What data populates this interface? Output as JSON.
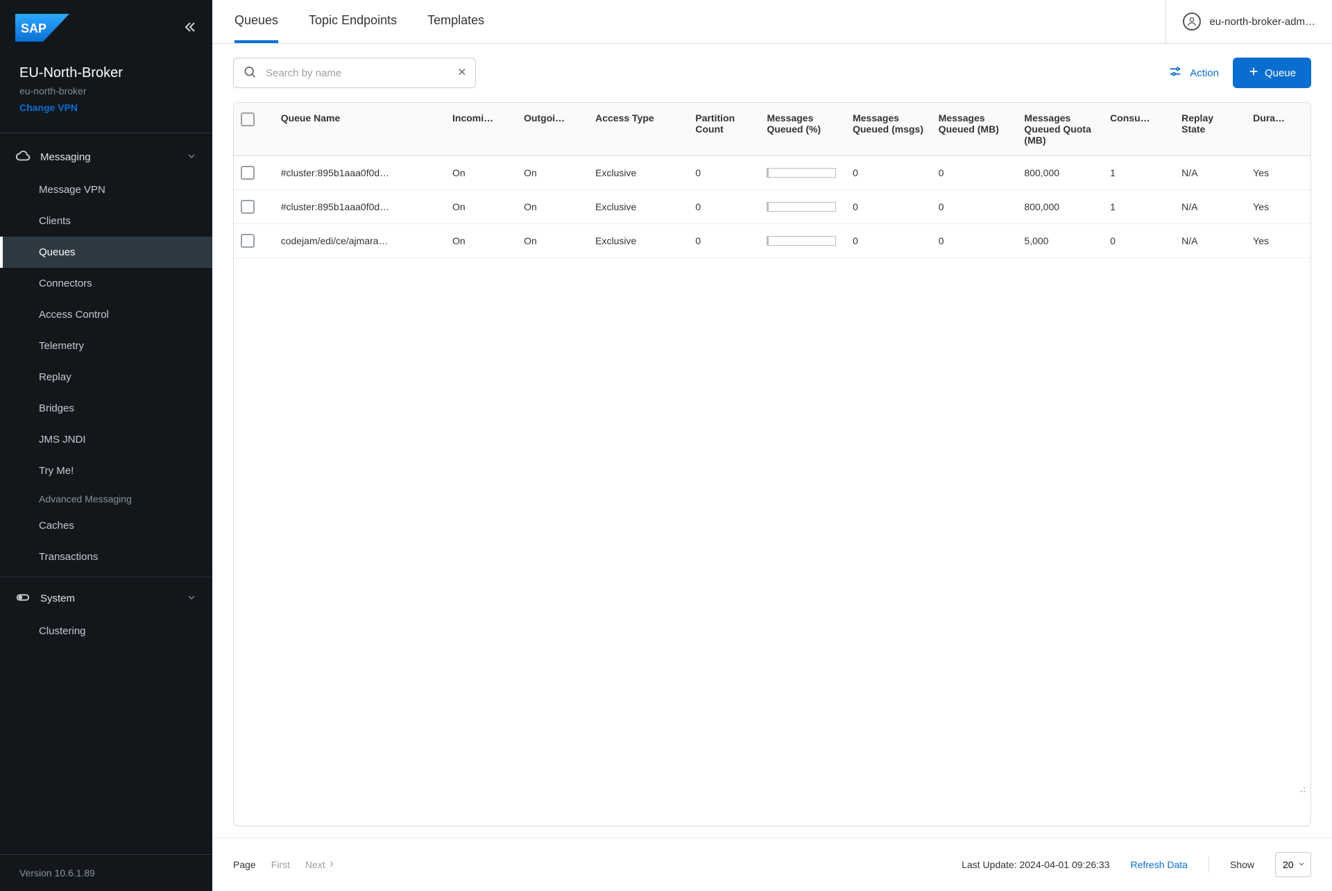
{
  "sidebar": {
    "broker_title": "EU-North-Broker",
    "broker_sub": "eu-north-broker",
    "change_vpn": "Change VPN",
    "messaging_label": "Messaging",
    "system_label": "System",
    "items": {
      "message_vpn": "Message VPN",
      "clients": "Clients",
      "queues": "Queues",
      "connectors": "Connectors",
      "access_control": "Access Control",
      "telemetry": "Telemetry",
      "replay": "Replay",
      "bridges": "Bridges",
      "jms_jndi": "JMS JNDI",
      "try_me": "Try Me!",
      "advanced_messaging": "Advanced Messaging",
      "caches": "Caches",
      "transactions": "Transactions",
      "clustering": "Clustering"
    },
    "version": "Version 10.6.1.89"
  },
  "tabs": {
    "queues": "Queues",
    "topic_endpoints": "Topic Endpoints",
    "templates": "Templates"
  },
  "user": {
    "label": "eu-north-broker-adm…"
  },
  "search": {
    "placeholder": "Search by name"
  },
  "actions": {
    "action_label": "Action",
    "queue_button": "Queue"
  },
  "columns": {
    "queue_name": "Queue Name",
    "incoming": "Incomi…",
    "outgoing": "Outgoi…",
    "access_type": "Access Type",
    "partition_count": "Partition Count",
    "messages_queued_pct": "Messages Queued (%)",
    "messages_queued_msgs": "Messages Queued (msgs)",
    "messages_queued_mb": "Messages Queued (MB)",
    "messages_queued_quota_mb": "Messages Queued Quota (MB)",
    "consumers": "Consu…",
    "replay_state": "Replay State",
    "durable": "Dura…"
  },
  "rows": [
    {
      "queue_name": "#cluster:895b1aaa0f0d…",
      "incoming": "On",
      "outgoing": "On",
      "access_type": "Exclusive",
      "partition_count": "0",
      "messages_queued_msgs": "0",
      "messages_queued_mb": "0",
      "quota_mb": "800,000",
      "consumers": "1",
      "replay_state": "N/A",
      "durable": "Yes"
    },
    {
      "queue_name": "#cluster:895b1aaa0f0d…",
      "incoming": "On",
      "outgoing": "On",
      "access_type": "Exclusive",
      "partition_count": "0",
      "messages_queued_msgs": "0",
      "messages_queued_mb": "0",
      "quota_mb": "800,000",
      "consumers": "1",
      "replay_state": "N/A",
      "durable": "Yes"
    },
    {
      "queue_name": "codejam/edi/ce/ajmara…",
      "incoming": "On",
      "outgoing": "On",
      "access_type": "Exclusive",
      "partition_count": "0",
      "messages_queued_msgs": "0",
      "messages_queued_mb": "0",
      "quota_mb": "5,000",
      "consumers": "0",
      "replay_state": "N/A",
      "durable": "Yes"
    }
  ],
  "footer": {
    "page_label": "Page",
    "first": "First",
    "next": "Next",
    "last_update": "Last Update: 2024-04-01 09:26:33",
    "refresh": "Refresh Data",
    "show_label": "Show",
    "show_value": "20"
  }
}
